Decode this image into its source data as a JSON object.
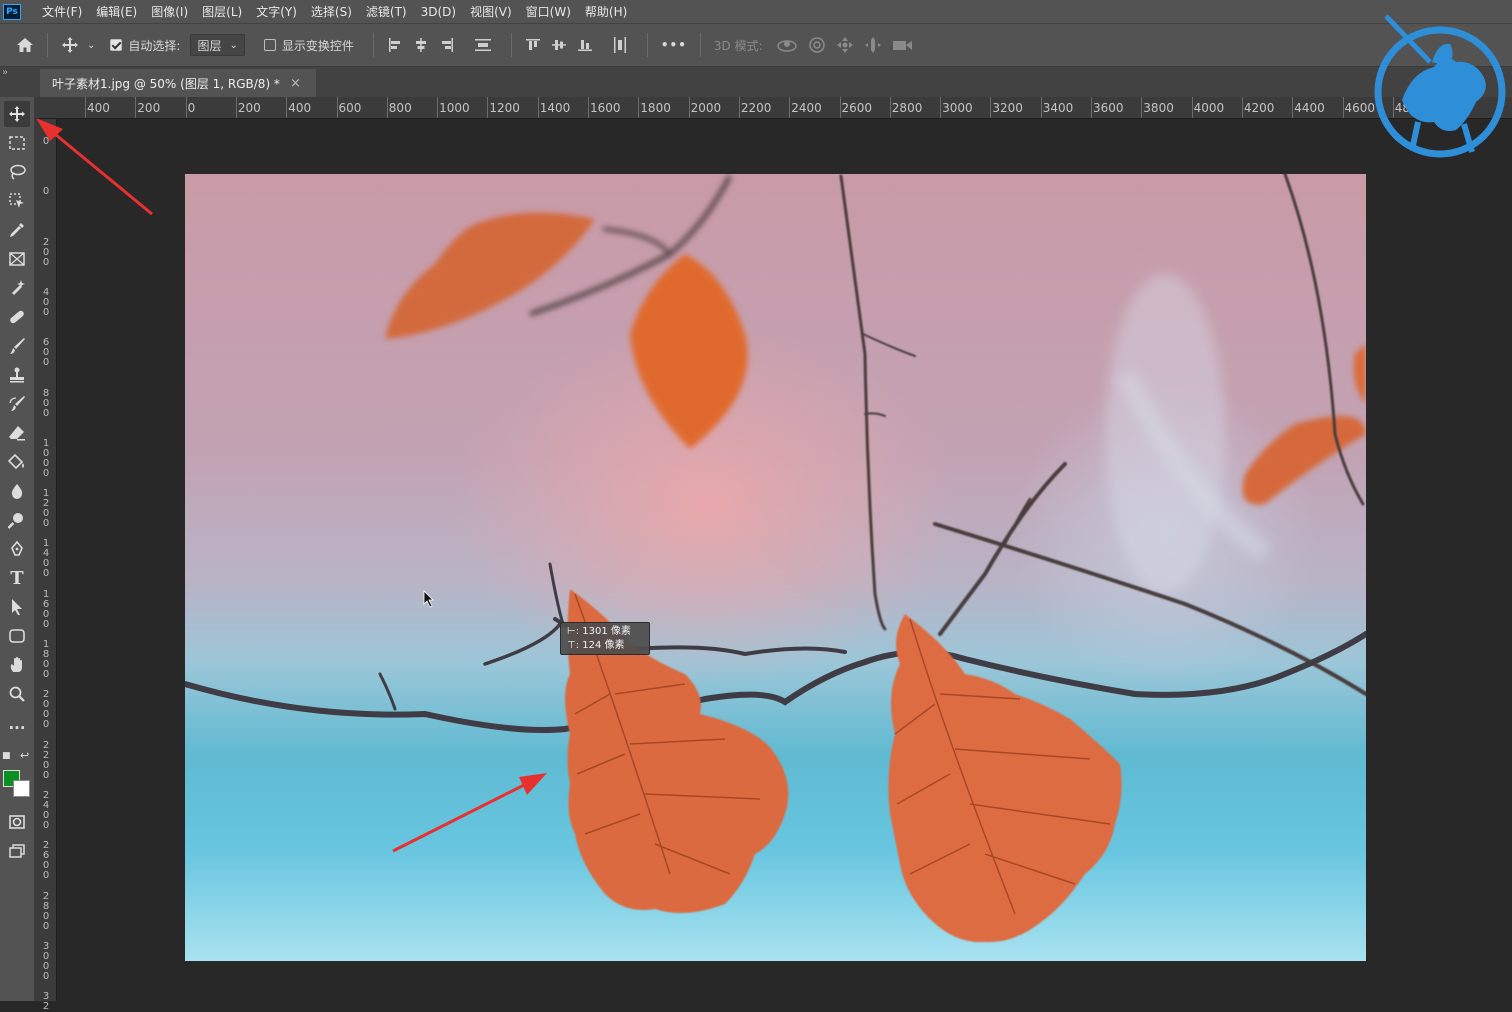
{
  "menubar": {
    "logo": "Ps",
    "items": [
      "文件(F)",
      "编辑(E)",
      "图像(I)",
      "图层(L)",
      "文字(Y)",
      "选择(S)",
      "滤镜(T)",
      "3D(D)",
      "视图(V)",
      "窗口(W)",
      "帮助(H)"
    ]
  },
  "options": {
    "auto_select_label": "自动选择:",
    "auto_select_checked": true,
    "auto_select_value": "图层",
    "transform_controls_label": "显示变换控件",
    "transform_controls_checked": false,
    "more": "•••",
    "mode_3d_label": "3D 模式:"
  },
  "tabstrip": {
    "collapse": "»",
    "doc_tab_title": "叶子素材1.jpg @ 50% (图层 1, RGB/8) *",
    "close": "×"
  },
  "ruler_top": [
    "400",
    "200",
    "0",
    "200",
    "400",
    "600",
    "800",
    "1000",
    "1200",
    "1400",
    "1600",
    "1800",
    "2000",
    "2200",
    "2400",
    "2600",
    "2800",
    "3000",
    "3200",
    "3400",
    "3600",
    "3800",
    "4000",
    "4200",
    "4400",
    "4600",
    "480"
  ],
  "ruler_left": [
    "0",
    "0",
    "2 0 0",
    "4 0 0",
    "6 0 0",
    "8 0 0",
    "1 0 0 0",
    "1 2 0 0",
    "1 4 0 0",
    "1 6 0 0",
    "1 8 0 0",
    "2 0 0 0",
    "2 2 0 0",
    "2 4 0 0",
    "2 6 0 0",
    "2 8 0 0",
    "3 0 0 0",
    "3 2"
  ],
  "tooltip": {
    "line1": "⊢: 1301 像素",
    "line2": "⊤:  124 像素"
  },
  "colors": {
    "foreground": "#0c8f22",
    "background": "#ffffff",
    "leaf": "#dc6b40",
    "annotation_arrow": "#e8312f",
    "watermark": "#2e8fd8"
  },
  "tools": [
    "move-tool",
    "marquee-tool",
    "lasso-tool",
    "object-select-tool",
    "eyedropper-tool",
    "frame-tool",
    "healing-brush-tool",
    "ruler-tool",
    "brush-tool",
    "clone-stamp-tool",
    "history-brush-tool",
    "eraser-tool",
    "paint-bucket-tool",
    "blur-tool",
    "dodge-tool",
    "pen-tool",
    "type-tool",
    "path-selection-tool",
    "shape-tool",
    "hand-tool",
    "zoom-tool",
    "more-tools"
  ]
}
